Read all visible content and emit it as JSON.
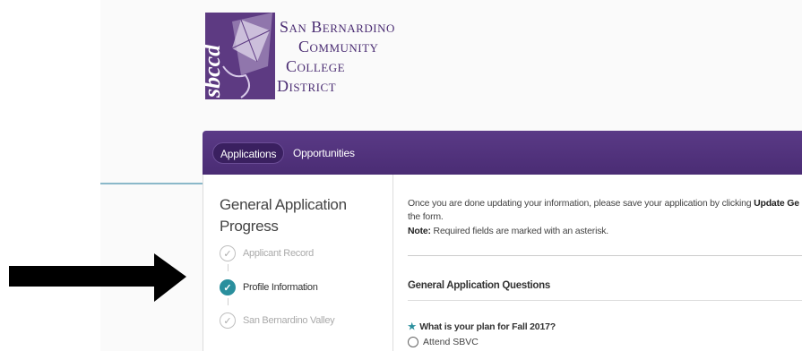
{
  "logo": {
    "seal_text": "sbccd",
    "line1": "San Bernardino",
    "line2": "Community",
    "line3": "College",
    "line4": "District"
  },
  "nav": {
    "tabs": [
      {
        "label": "Applications",
        "active": true
      },
      {
        "label": "Opportunities",
        "active": false
      }
    ]
  },
  "sidebar": {
    "title": "General Application Progress",
    "steps": [
      {
        "label": "Applicant Record",
        "state": "pending"
      },
      {
        "label": "Profile Information",
        "state": "current-done"
      },
      {
        "label": "San Bernardino Valley",
        "state": "pending"
      }
    ]
  },
  "content": {
    "info_prefix": "Once you are done updating your information, please save your application by clicking ",
    "info_bold": "Update Ge",
    "info_line2": "the form.",
    "note_label": "Note:",
    "note_text": " Required fields are marked with an asterisk.",
    "section_title": "General Application Questions",
    "question_star": "★",
    "question": "What is your plan for Fall 2017?",
    "option1": "Attend SBVC"
  },
  "colors": {
    "nav_purple": "#4a2c74",
    "accent_teal": "#2a8f9d",
    "logo_purple": "#5d3a82"
  },
  "icons": {
    "check": "✓",
    "annotation_arrow": "right-arrow-icon"
  }
}
